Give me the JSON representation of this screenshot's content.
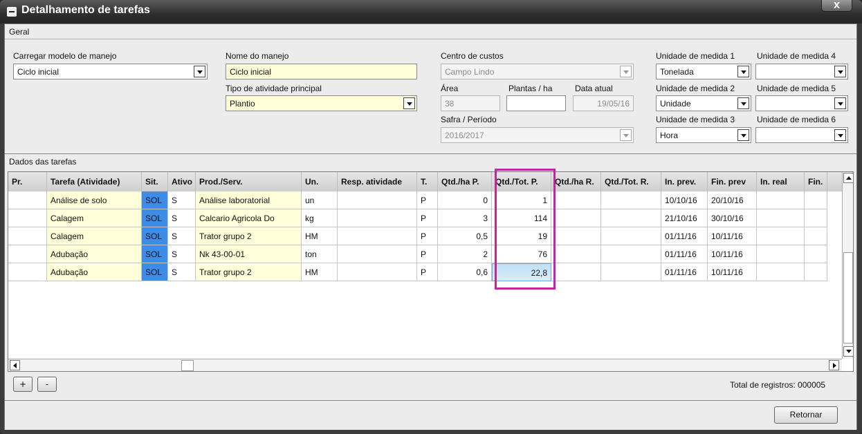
{
  "window": {
    "title": "Detalhamento de tarefas",
    "close": "X"
  },
  "geral": {
    "section_label": "Geral",
    "carregar_label": "Carregar modelo de manejo",
    "carregar_value": "Ciclo inicial",
    "nome_label": "Nome do manejo",
    "nome_value": "Ciclo inicial",
    "tipo_label": "Tipo de atividade principal",
    "tipo_value": "Plantio",
    "centro_label": "Centro de custos",
    "centro_value": "Campo Lindo",
    "area_label": "Área",
    "area_value": "38",
    "plantas_label": "Plantas / ha",
    "plantas_value": "",
    "data_label": "Data atual",
    "data_value": "19/05/16",
    "safra_label": "Safra / Período",
    "safra_value": "2016/2017",
    "um1_label": "Unidade de medida 1",
    "um1_value": "Tonelada",
    "um2_label": "Unidade de medida 2",
    "um2_value": "Unidade",
    "um3_label": "Unidade de medida 3",
    "um3_value": "Hora",
    "um4_label": "Unidade de medida 4",
    "um4_value": "",
    "um5_label": "Unidade de medida 5",
    "um5_value": "",
    "um6_label": "Unidade de medida 6",
    "um6_value": ""
  },
  "tarefas": {
    "section_label": "Dados das tarefas",
    "columns": [
      "Pr.",
      "Tarefa (Atividade)",
      "Sit.",
      "Ativo",
      "Prod./Serv.",
      "Un.",
      "Resp. atividade",
      "T.",
      "Qtd./ha P.",
      "Qtd./Tot. P.",
      "Qtd./ha  R.",
      "Qtd./Tot. R.",
      "In. prev.",
      "Fin. prev",
      "In. real",
      "Fin."
    ],
    "rows": [
      [
        "",
        "Análise de solo",
        "SOL",
        "S",
        "Análise laboratorial",
        "un",
        "",
        "P",
        "0",
        "1",
        "",
        "",
        "10/10/16",
        "20/10/16",
        "",
        ""
      ],
      [
        "",
        "Calagem",
        "SOL",
        "S",
        "Calcario Agricola Do",
        "kg",
        "",
        "P",
        "3",
        "114",
        "",
        "",
        "21/10/16",
        "30/10/16",
        "",
        ""
      ],
      [
        "",
        "Calagem",
        "SOL",
        "S",
        "Trator grupo 2",
        "HM",
        "",
        "P",
        "0,5",
        "19",
        "",
        "",
        "01/11/16",
        "10/11/16",
        "",
        ""
      ],
      [
        "",
        "Adubação",
        "SOL",
        "S",
        "Nk 43-00-01",
        "ton",
        "",
        "P",
        "2",
        "76",
        "",
        "",
        "01/11/16",
        "10/11/16",
        "",
        ""
      ],
      [
        "",
        "Adubação",
        "SOL",
        "S",
        "Trator grupo 2",
        "HM",
        "",
        "P",
        "0,6",
        "22,8",
        "",
        "",
        "01/11/16",
        "10/11/16",
        "",
        ""
      ]
    ],
    "add_label": "+",
    "remove_label": "-",
    "total_label": "Total de registros: 000005"
  },
  "footer": {
    "retornar_label": "Retornar"
  },
  "colors": {
    "sit_bg": "#3d8de8",
    "yellow_field": "#ffffd9",
    "highlight": "#c026a0"
  }
}
